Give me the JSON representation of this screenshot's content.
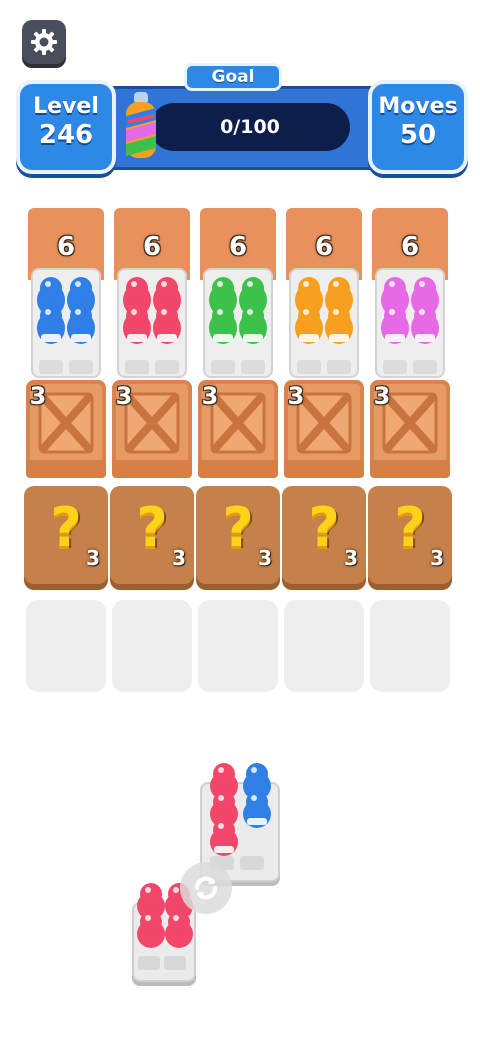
{
  "hud": {
    "level_label": "Level",
    "level_value": "246",
    "goal_label": "Goal",
    "goal_progress": "0/100",
    "goal_fraction": 0,
    "moves_label": "Moves",
    "moves_value": "50",
    "settings_icon": "gear-icon"
  },
  "columns": [
    {
      "lid_count": "6",
      "bottle_color": "#2f7fe6",
      "crate_count": "3",
      "mystery_count": "3"
    },
    {
      "lid_count": "6",
      "bottle_color": "#f0476a",
      "crate_count": "3",
      "mystery_count": "3"
    },
    {
      "lid_count": "6",
      "bottle_color": "#3cc24a",
      "crate_count": "3",
      "mystery_count": "3"
    },
    {
      "lid_count": "6",
      "bottle_color": "#f7a020",
      "crate_count": "3",
      "mystery_count": "3"
    },
    {
      "lid_count": "6",
      "bottle_color": "#e66ae6",
      "crate_count": "3",
      "mystery_count": "3"
    }
  ],
  "mystery_symbol": "?",
  "colors": {
    "accent_blue": "#2e88e6",
    "lid_orange": "#e8915c",
    "crate_orange": "#e89a64",
    "mystery_brown": "#c6814b",
    "pink": "#f0476a",
    "blue": "#2f7fe6"
  },
  "pieces": {
    "swap_icon": "swap-icon"
  }
}
